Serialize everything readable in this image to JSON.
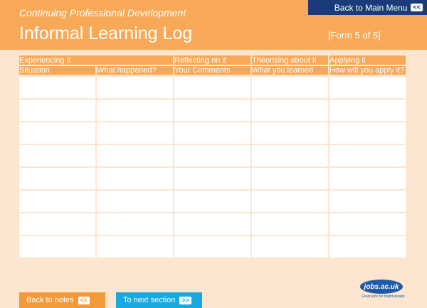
{
  "header": {
    "subtitle": "Continuing Professional Development",
    "title": "Informal Learning Log",
    "form_number": "[Form 5 of 5]",
    "main_menu_label": "Back to Main Menu",
    "main_menu_chevron": "<<"
  },
  "table": {
    "groups": [
      "Experiencing it",
      "Reflecting on it",
      "Theorising about it",
      "Applying it"
    ],
    "columns": [
      "Situation",
      "What happened?",
      "Your Comments",
      "What you learned",
      "How will you apply it?"
    ],
    "row_count": 8
  },
  "footer": {
    "back_label": "Back to notes",
    "back_chevron": "<<",
    "next_label": "To next section",
    "next_chevron": ">>"
  },
  "logo": {
    "text": "jobs.ac.uk",
    "tagline": "Great jobs for bright people"
  },
  "colors": {
    "accent": "#f7a957",
    "background": "#fde6cf",
    "menu": "#1b3a7a",
    "next_button": "#19a9e1"
  }
}
